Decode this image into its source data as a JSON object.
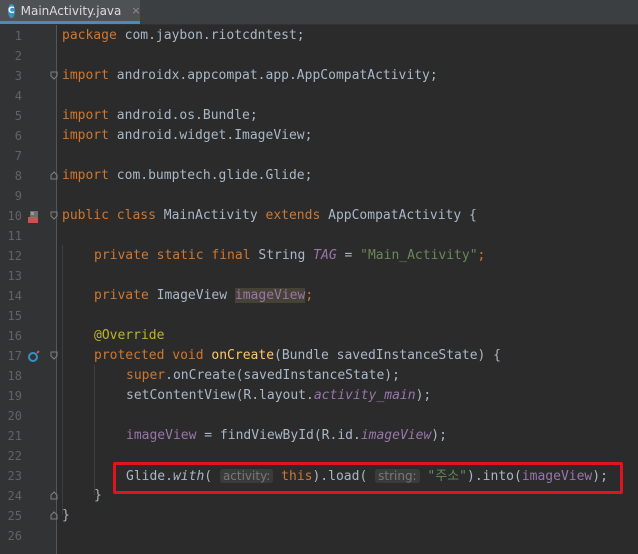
{
  "tab": {
    "icon_letter": "C",
    "title": "MainActivity.java",
    "close": "×"
  },
  "lines": [
    {
      "n": "1"
    },
    {
      "n": "2"
    },
    {
      "n": "3"
    },
    {
      "n": "4"
    },
    {
      "n": "5"
    },
    {
      "n": "6"
    },
    {
      "n": "7"
    },
    {
      "n": "8"
    },
    {
      "n": "9"
    },
    {
      "n": "10"
    },
    {
      "n": "11"
    },
    {
      "n": "12"
    },
    {
      "n": "13"
    },
    {
      "n": "14"
    },
    {
      "n": "15"
    },
    {
      "n": "16"
    },
    {
      "n": "17"
    },
    {
      "n": "18"
    },
    {
      "n": "19"
    },
    {
      "n": "20"
    },
    {
      "n": "21"
    },
    {
      "n": "22"
    },
    {
      "n": "23"
    },
    {
      "n": "24"
    },
    {
      "n": "25"
    },
    {
      "n": "26"
    }
  ],
  "code": {
    "l1_kw": "package",
    "l1_rest": " com.jaybon.riotcdntest;",
    "l3_kw": "import",
    "l3_rest": " androidx.appcompat.app.AppCompatActivity;",
    "l5_kw": "import",
    "l5_rest": " android.os.Bundle;",
    "l6_kw": "import",
    "l6_rest": " android.widget.ImageView;",
    "l8_kw": "import",
    "l8_rest": " com.bumptech.glide.Glide;",
    "l10_kw1": "public class",
    "l10_name": " MainActivity ",
    "l10_kw2": "extends",
    "l10_rest": " AppCompatActivity {",
    "l12_kw": "private static final",
    "l12_type": " String ",
    "l12_field": "TAG",
    "l12_eq": " = ",
    "l12_str": "\"Main_Activity\"",
    "l12_end": ";",
    "l14_kw": "private",
    "l14_type": " ImageView ",
    "l14_field": "imageView",
    "l14_end": ";",
    "l16_ann": "@Override",
    "l17_kw": "protected void",
    "l17_sp": " ",
    "l17_fn": "onCreate",
    "l17_rest": "(Bundle savedInstanceState) {",
    "l18_kw": "super",
    "l18_rest": ".onCreate(savedInstanceState);",
    "l19_a": "setContentView(R.layout.",
    "l19_field": "activity_main",
    "l19_b": ");",
    "l21_field": "imageView",
    "l21_a": " = findViewById(R.id.",
    "l21_field2": "imageView",
    "l21_b": ");",
    "l23_a": "Glide.",
    "l23_with": "with",
    "l23_p1": "( ",
    "l23_hint1": "activity:",
    "l23_this": " this",
    "l23_p2": ").load( ",
    "l23_hint2": "string:",
    "l23_str": " \"주소\"",
    "l23_p3": ").into(",
    "l23_field": "imageView",
    "l23_p4": ");",
    "l24": "}",
    "l25": "}"
  }
}
